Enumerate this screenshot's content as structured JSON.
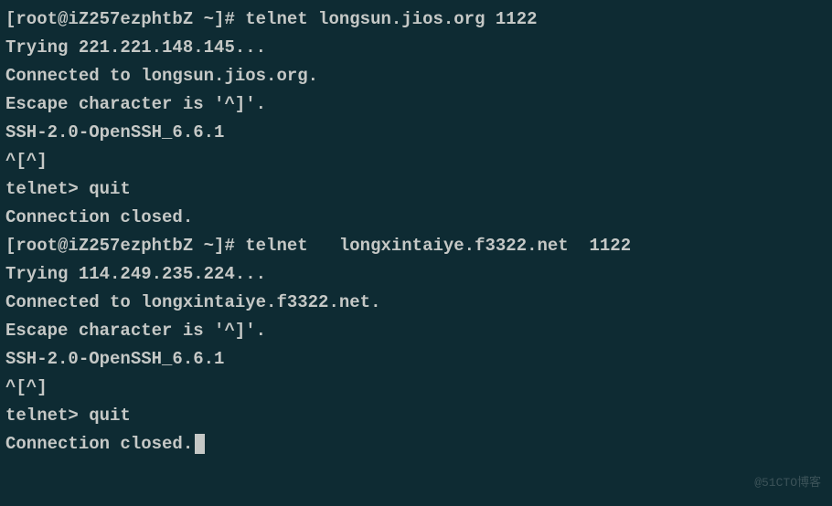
{
  "lines": {
    "l0": "[root@iZ257ezphtbZ ~]# telnet longsun.jios.org 1122",
    "l1": "Trying 221.221.148.145...",
    "l2": "Connected to longsun.jios.org.",
    "l3": "Escape character is '^]'.",
    "l4": "SSH-2.0-OpenSSH_6.6.1",
    "l5": "^[^]",
    "l6": "telnet> quit",
    "l7": "Connection closed.",
    "l8": "[root@iZ257ezphtbZ ~]# telnet   longxintaiye.f3322.net  1122",
    "l9": "Trying 114.249.235.224...",
    "l10": "Connected to longxintaiye.f3322.net.",
    "l11": "Escape character is '^]'.",
    "l12": "SSH-2.0-OpenSSH_6.6.1",
    "l13": "^[^]",
    "l14": "telnet> quit",
    "l15": "Connection closed."
  },
  "watermark": "@51CTO博客"
}
